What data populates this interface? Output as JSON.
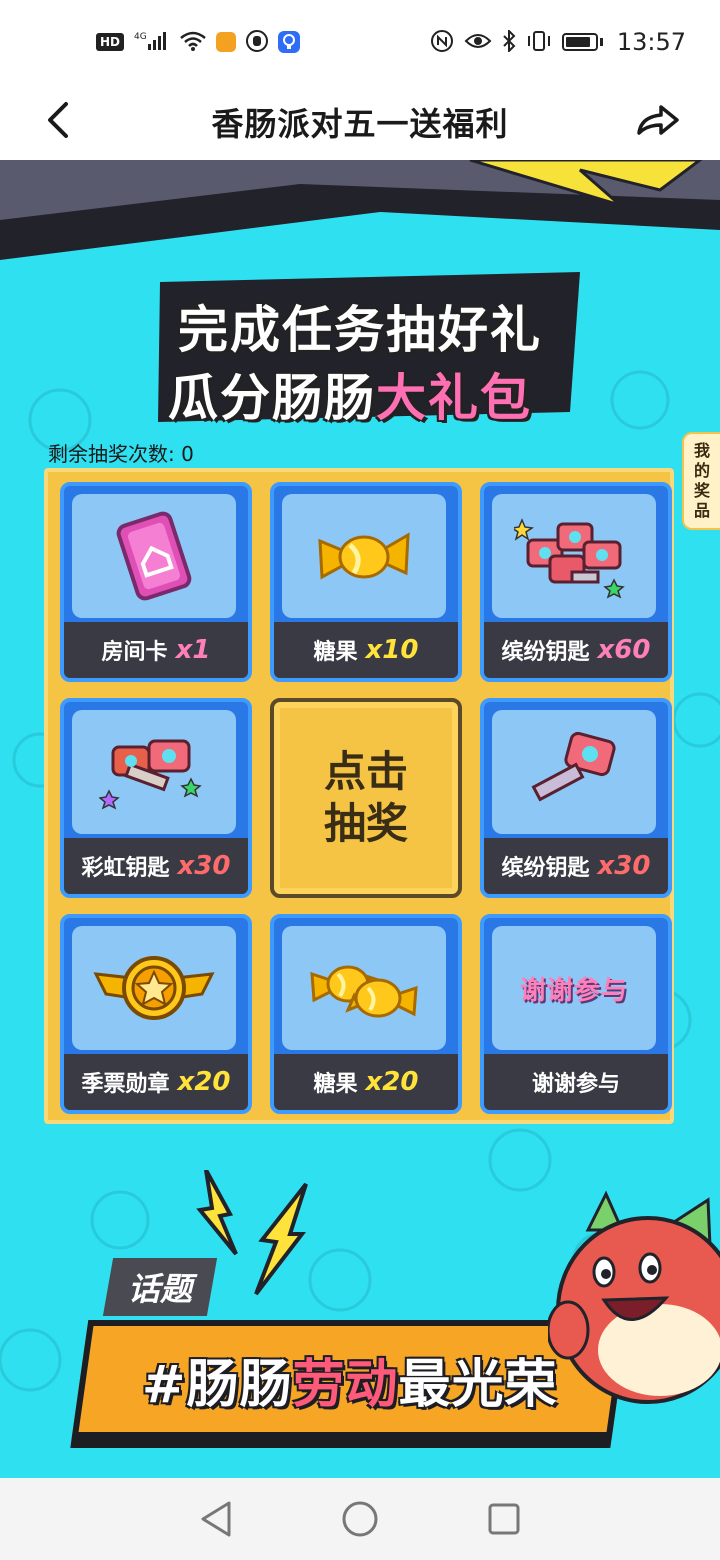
{
  "status_bar": {
    "network_label": "4G",
    "hd_label": "HD",
    "time": "13:57",
    "icons": [
      "signal-icon",
      "wifi-icon",
      "app-icon",
      "glove-icon",
      "bulb-app-icon",
      "nfc-icon",
      "eye-icon",
      "bluetooth-icon",
      "vibrate-icon",
      "battery-icon"
    ]
  },
  "header": {
    "title": "香肠派对五一送福利",
    "back_icon": "chevron-left-icon",
    "share_icon": "share-arrow-icon"
  },
  "banner": {
    "line1": "完成任务抽好礼",
    "line2_prefix": "瓜分肠肠",
    "line2_highlight": "大礼包"
  },
  "lottery": {
    "remaining_label": "剩余抽奖次数: 0",
    "my_prizes_label": [
      "我",
      "的",
      "奖",
      "品"
    ],
    "draw_button_line1": "点击",
    "draw_button_line2": "抽奖",
    "prizes": [
      {
        "name": "房间卡",
        "qty": "x1",
        "icon": "room-card-icon"
      },
      {
        "name": "糖果",
        "qty": "x10",
        "icon": "candy-icon"
      },
      {
        "name": "缤纷钥匙",
        "qty": "x60",
        "icon": "keys-pile-icon"
      },
      {
        "name": "彩虹钥匙",
        "qty": "x30",
        "icon": "rainbow-key-icon"
      },
      {
        "name": "缤纷钥匙",
        "qty": "x30",
        "icon": "key-icon"
      },
      {
        "name": "季票勋章",
        "qty": "x20",
        "icon": "medal-icon"
      },
      {
        "name": "糖果",
        "qty": "x20",
        "icon": "candies-icon"
      },
      {
        "name": "谢谢参与",
        "qty": "",
        "icon": "thanks-art",
        "art_text": "谢谢参与"
      }
    ]
  },
  "topic": {
    "tag": "话题",
    "hash_prefix": "#肠肠",
    "highlight": "劳动",
    "suffix": "最光荣"
  },
  "colors": {
    "background": "#2fe0f0",
    "frame": "#f6c445",
    "prize_border": "#3d9bff",
    "caption_bg": "#3a3a44",
    "pink": "#ff7fb8",
    "yellow": "#ffe23a"
  },
  "nav": {
    "back": "triangle-back-icon",
    "home": "circle-home-icon",
    "recent": "square-recent-icon"
  }
}
